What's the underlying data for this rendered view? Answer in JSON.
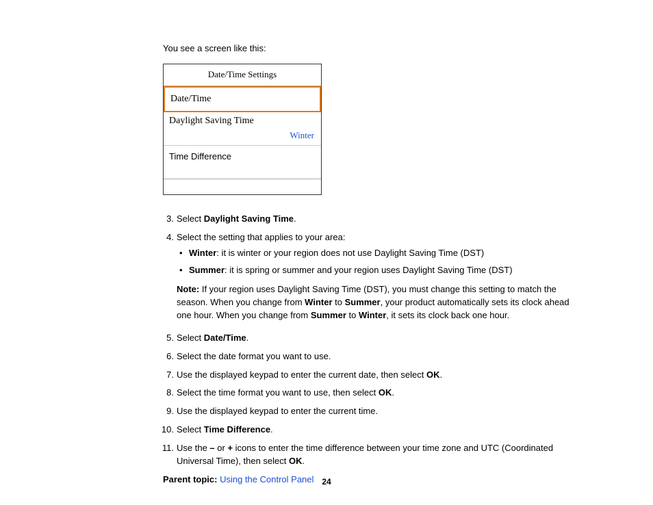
{
  "intro": "You see a screen like this:",
  "device": {
    "title": "Date/Time Settings",
    "selected": "Date/Time",
    "row2": "Daylight Saving Time",
    "row2_value": "Winter",
    "row3": "Time Difference"
  },
  "step3": {
    "pre": "Select ",
    "bold": "Daylight Saving Time",
    "post": "."
  },
  "step4": {
    "text": "Select the setting that applies to your area:",
    "b1_bold": "Winter",
    "b1_rest": ": it is winter or your region does not use Daylight Saving Time (DST)",
    "b2_bold": "Summer",
    "b2_rest": ": it is spring or summer and your region uses Daylight Saving Time (DST)",
    "note_label": "Note:",
    "note_a": " If your region uses Daylight Saving Time (DST), you must change this setting to match the season. When you change from ",
    "note_b1": "Winter",
    "note_b": " to ",
    "note_b2": "Summer",
    "note_c": ", your product automatically sets its clock ahead one hour. When you change from ",
    "note_b3": "Summer",
    "note_d": " to ",
    "note_b4": "Winter",
    "note_e": ", it sets its clock back one hour."
  },
  "step5": {
    "pre": "Select ",
    "bold": "Date/Time",
    "post": "."
  },
  "step6": "Select the date format you want to use.",
  "step7": {
    "pre": "Use the displayed keypad to enter the current date, then select ",
    "bold": "OK",
    "post": "."
  },
  "step8": {
    "pre": "Select the time format you want to use, then select ",
    "bold": "OK",
    "post": "."
  },
  "step9": "Use the displayed keypad to enter the current time.",
  "step10": {
    "pre": "Select ",
    "bold": "Time Difference",
    "post": "."
  },
  "step11": {
    "a": "Use the ",
    "m": "–",
    "b": " or ",
    "p": "+",
    "c": " icons to enter the time difference between your time zone and UTC (Coordinated Universal Time), then select ",
    "ok": "OK",
    "d": "."
  },
  "parent": {
    "label": "Parent topic:",
    "sp": " ",
    "link": "Using the Control Panel"
  },
  "page": "24"
}
